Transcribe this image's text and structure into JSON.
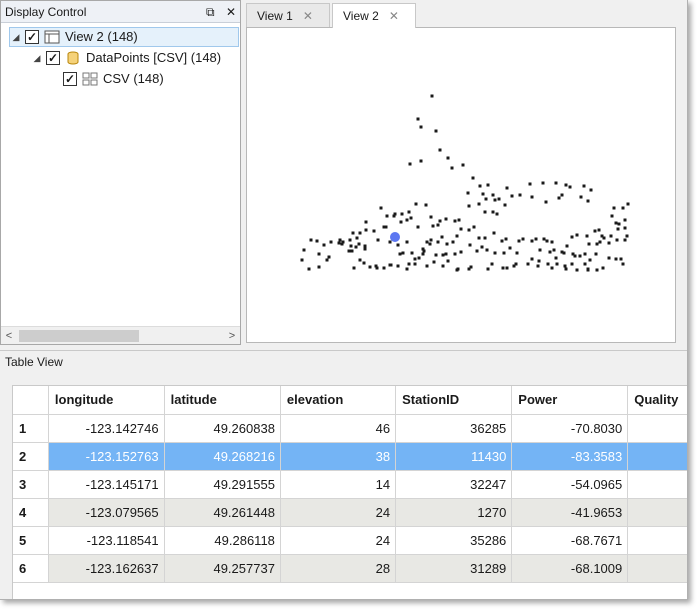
{
  "display_control": {
    "title": "Display Control",
    "tree": [
      {
        "label": "View 2 (148)",
        "level": 0,
        "selected": true
      },
      {
        "label": "DataPoints [CSV] (148)",
        "level": 1,
        "selected": false
      },
      {
        "label": "CSV (148)",
        "level": 2,
        "selected": false
      }
    ]
  },
  "tabs": [
    {
      "label": "View 1",
      "active": false
    },
    {
      "label": "View 2",
      "active": true
    }
  ],
  "table_view": {
    "title": "Table View",
    "columns": [
      "longitude",
      "latitude",
      "elevation",
      "StationID",
      "Power",
      "Quality"
    ],
    "rows": [
      {
        "id": "1",
        "cells": [
          "-123.142746",
          "49.260838",
          "46",
          "36285",
          "-70.8030",
          ""
        ]
      },
      {
        "id": "2",
        "cells": [
          "-123.152763",
          "49.268216",
          "38",
          "11430",
          "-83.3583",
          ""
        ]
      },
      {
        "id": "3",
        "cells": [
          "-123.145171",
          "49.291555",
          "14",
          "32247",
          "-54.0965",
          ""
        ]
      },
      {
        "id": "4",
        "cells": [
          "-123.079565",
          "49.261448",
          "24",
          "1270",
          "-41.9653",
          ""
        ]
      },
      {
        "id": "5",
        "cells": [
          "-123.118541",
          "49.286118",
          "24",
          "35286",
          "-68.7671",
          ""
        ]
      },
      {
        "id": "6",
        "cells": [
          "-123.162637",
          "49.257737",
          "28",
          "31289",
          "-68.1009",
          ""
        ]
      }
    ],
    "selected_row": "2"
  },
  "map_points_color": "#1a1a1a",
  "highlight_color": "#3355ee"
}
